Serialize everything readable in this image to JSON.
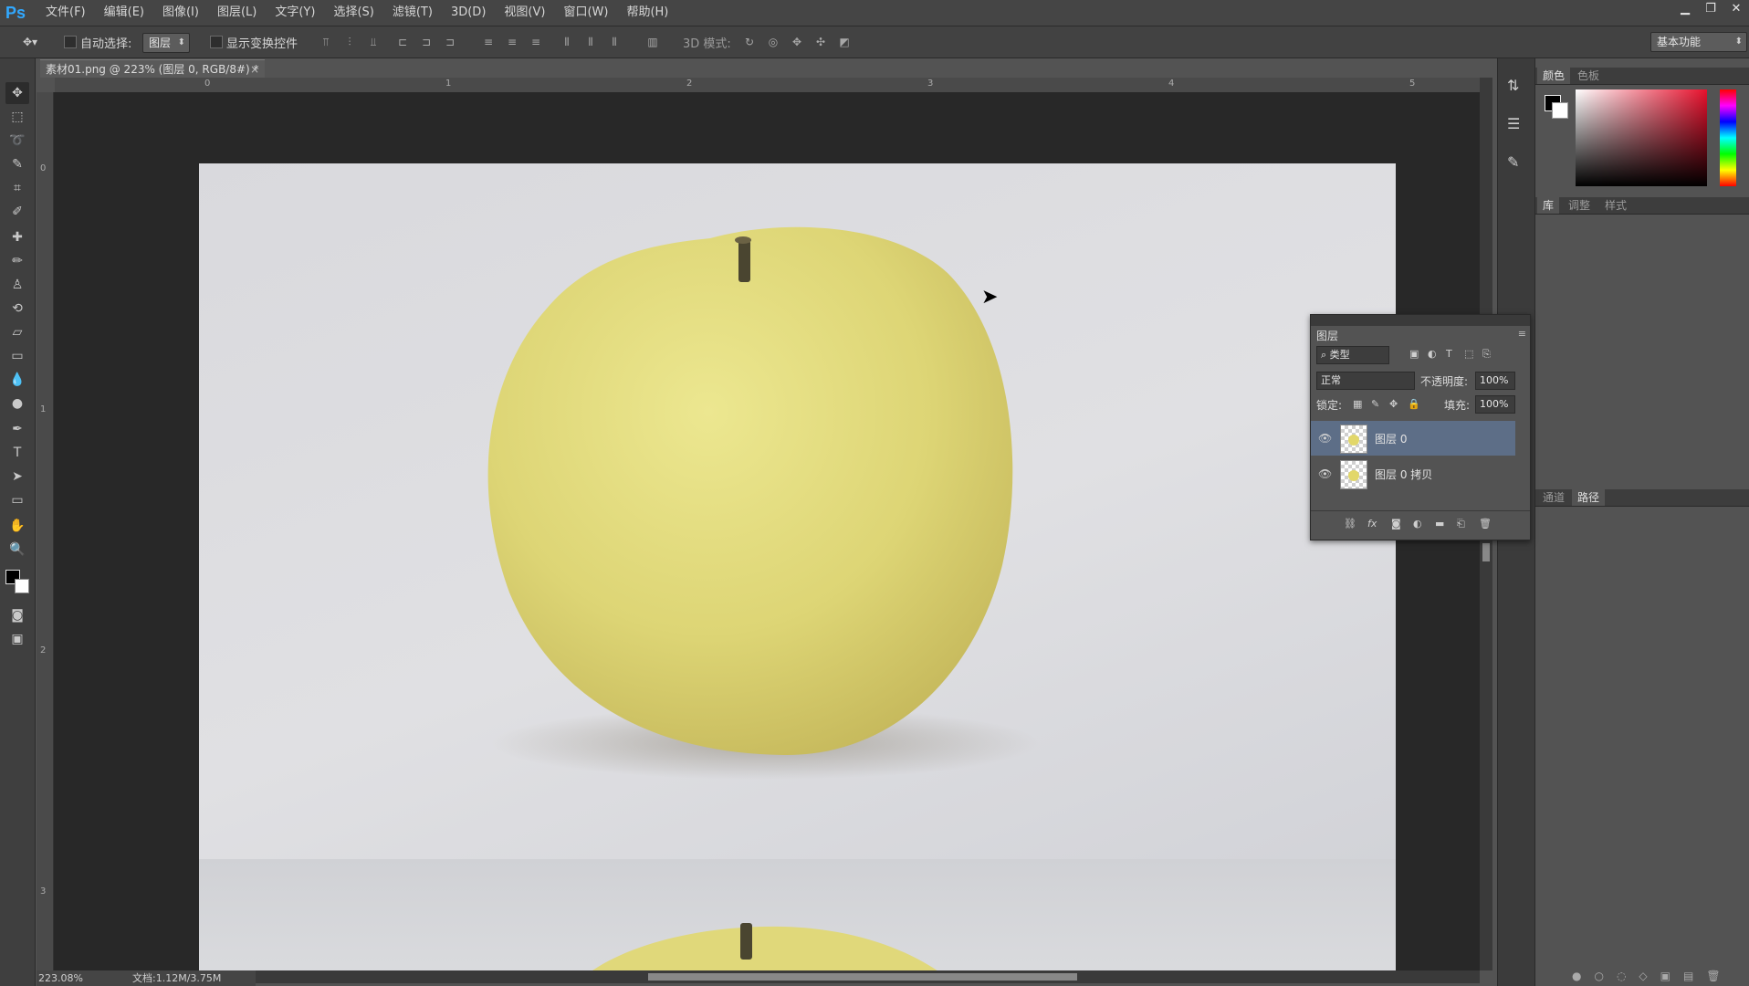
{
  "app": {
    "logo": "Ps"
  },
  "menu": [
    "文件(F)",
    "编辑(E)",
    "图像(I)",
    "图层(L)",
    "文字(Y)",
    "选择(S)",
    "滤镜(T)",
    "3D(D)",
    "视图(V)",
    "窗口(W)",
    "帮助(H)"
  ],
  "options": {
    "auto_select_label": "自动选择:",
    "auto_select_value": "图层",
    "show_transform_label": "显示变换控件",
    "mode3d_label": "3D 模式:",
    "workspace": "基本功能"
  },
  "document": {
    "tab_title": "素材01.png @ 223% (图层 0, RGB/8#) *",
    "zoom": "223.08%",
    "doc_size": "文档:1.12M/3.75M",
    "ruler_top": [
      "0",
      "1",
      "2",
      "3",
      "4",
      "5"
    ],
    "ruler_left": [
      "0",
      "1",
      "2",
      "3"
    ]
  },
  "panels": {
    "color_tabs": [
      "颜色",
      "色板"
    ],
    "lib_tabs": [
      "库",
      "调整",
      "样式"
    ],
    "path_tabs": [
      "通道",
      "路径"
    ]
  },
  "layers": {
    "title": "图层",
    "filter_kind": "类型",
    "blend_mode": "正常",
    "opacity_label": "不透明度:",
    "opacity": "100%",
    "lock_label": "锁定:",
    "fill_label": "填充:",
    "fill": "100%",
    "items": [
      {
        "name": "图层 0",
        "selected": true
      },
      {
        "name": "图层 0 拷贝",
        "selected": false
      }
    ]
  },
  "colors": {
    "accent": "#31a8ff",
    "selected_layer": "#5d6e87"
  }
}
